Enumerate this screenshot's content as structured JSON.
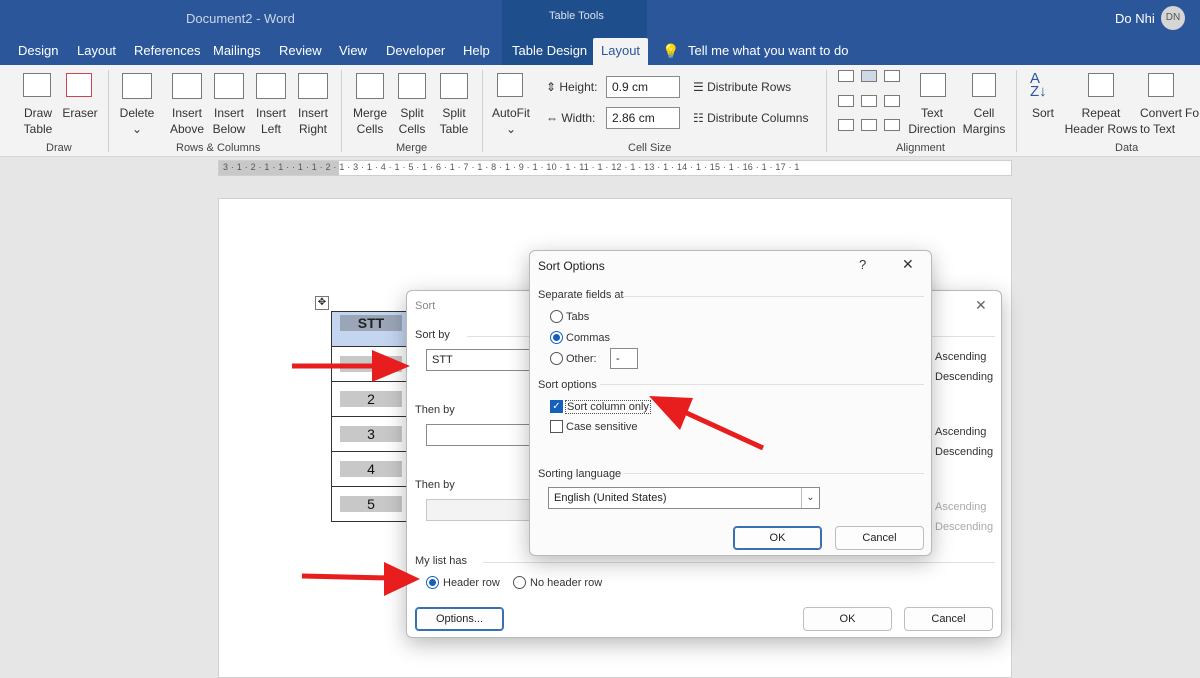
{
  "window": {
    "title": "Document2  -  Word",
    "user": "Do Nhi",
    "initials": "DN",
    "context_group": "Table Tools"
  },
  "tabs": [
    "Design",
    "Layout",
    "References",
    "Mailings",
    "Review",
    "View",
    "Developer",
    "Help",
    "Table Design",
    "Layout"
  ],
  "tell_me": "Tell me what you want to do",
  "ribbon": {
    "draw_table": [
      "Draw",
      "Table"
    ],
    "eraser": "Eraser",
    "delete": "Delete",
    "insert_above": [
      "Insert",
      "Above"
    ],
    "insert_below": [
      "Insert",
      "Below"
    ],
    "insert_left": [
      "Insert",
      "Left"
    ],
    "insert_right": [
      "Insert",
      "Right"
    ],
    "merge_cells": [
      "Merge",
      "Cells"
    ],
    "split_cells": [
      "Split",
      "Cells"
    ],
    "split_table": [
      "Split",
      "Table"
    ],
    "autofit": "AutoFit",
    "height_label": "Height:",
    "height_value": "0.9 cm",
    "width_label": "Width:",
    "width_value": "2.86 cm",
    "distribute_rows": "Distribute Rows",
    "distribute_columns": "Distribute Columns",
    "text_direction": [
      "Text",
      "Direction"
    ],
    "cell_margins": [
      "Cell",
      "Margins"
    ],
    "sort": "Sort",
    "repeat_header": [
      "Repeat",
      "Header Rows"
    ],
    "convert": [
      "Convert",
      "to Text"
    ],
    "formula_partial": "Fo",
    "groups": [
      "Draw",
      "Rows & Columns",
      "Merge",
      "Cell Size",
      "Alignment",
      "Data"
    ]
  },
  "ruler": "3 · 1 · 2 · 1 · 1 ·         · 1 · 1 · 2 · 1 · 3 · 1 · 4 · 1 · 5 · 1 · 6 · 1 · 7 · 1 · 8 · 1 · 9 · 1 · 10 · 1 · 11 · 1 · 12 · 1 · 13 · 1 · 14 · 1 · 15 · 1 · 16 · 1 · 17 · 1",
  "table": {
    "header": "STT",
    "rows": [
      "",
      "2",
      "3",
      "4",
      "5"
    ]
  },
  "sort_dialog": {
    "title": "Sort",
    "sort_by": "Sort by",
    "sort_by_value": "STT",
    "then_by_1": "Then by",
    "then_by_2": "Then by",
    "ascending": "Ascending",
    "descending": "Descending",
    "my_list_has": "My list has",
    "header_row": "Header row",
    "no_header_row": "No header row",
    "options_btn": "Options...",
    "ok": "OK",
    "cancel": "Cancel"
  },
  "sort_options": {
    "title": "Sort Options",
    "help": "?",
    "close": "✕",
    "separate_fields": "Separate fields at",
    "tabs": "Tabs",
    "commas": "Commas",
    "other": "Other:",
    "other_value": "-",
    "sort_options_label": "Sort options",
    "sort_column_only": "Sort column only",
    "case_sensitive": "Case sensitive",
    "sorting_language": "Sorting language",
    "language_value": "English (United States)",
    "ok": "OK",
    "cancel": "Cancel"
  },
  "colors": {
    "accent": "#2b579a",
    "arrow": "#e81e1e",
    "dialog_blue": "#1560bd"
  }
}
